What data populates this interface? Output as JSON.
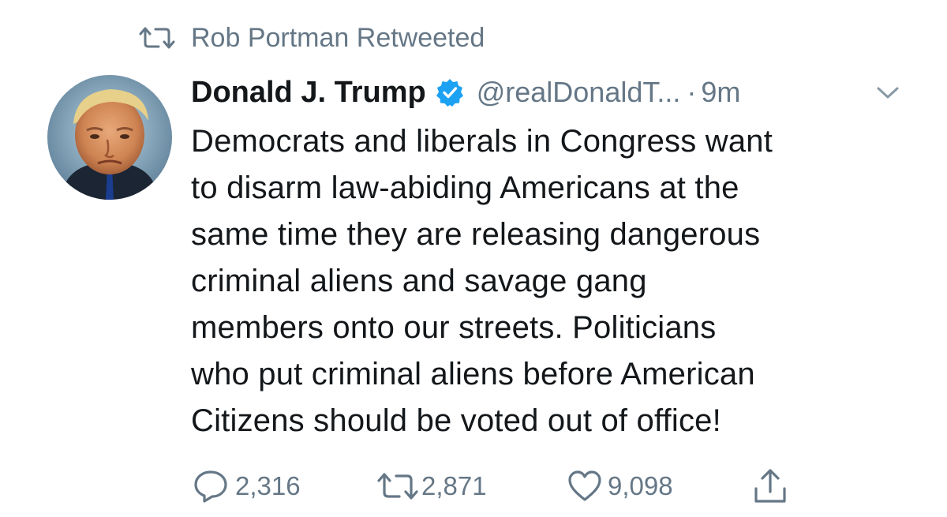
{
  "retweet_context": {
    "icon": "retweet-icon",
    "text": "Rob Portman Retweeted"
  },
  "author": {
    "display_name": "Donald J. Trump",
    "verified": true,
    "handle": "@realDonaldT...",
    "separator": "·",
    "time": "9m"
  },
  "tweet": {
    "lines": [
      "Democrats and liberals in Congress want",
      "to disarm law-abiding Americans at the",
      "same time they are releasing dangerous",
      "criminal aliens and savage gang",
      "members onto our streets. Politicians",
      "who put criminal aliens before American",
      "Citizens should be voted out of office!"
    ]
  },
  "actions": {
    "reply": {
      "icon": "reply-icon",
      "count": "2,316"
    },
    "retweet": {
      "icon": "retweet-icon",
      "count": "2,871"
    },
    "like": {
      "icon": "heart-icon",
      "count": "9,098"
    },
    "share": {
      "icon": "share-icon"
    }
  },
  "colors": {
    "secondary_text": "#657786",
    "primary_text": "#14171a",
    "verified_blue": "#1da1f2",
    "background": "#ffffff"
  }
}
